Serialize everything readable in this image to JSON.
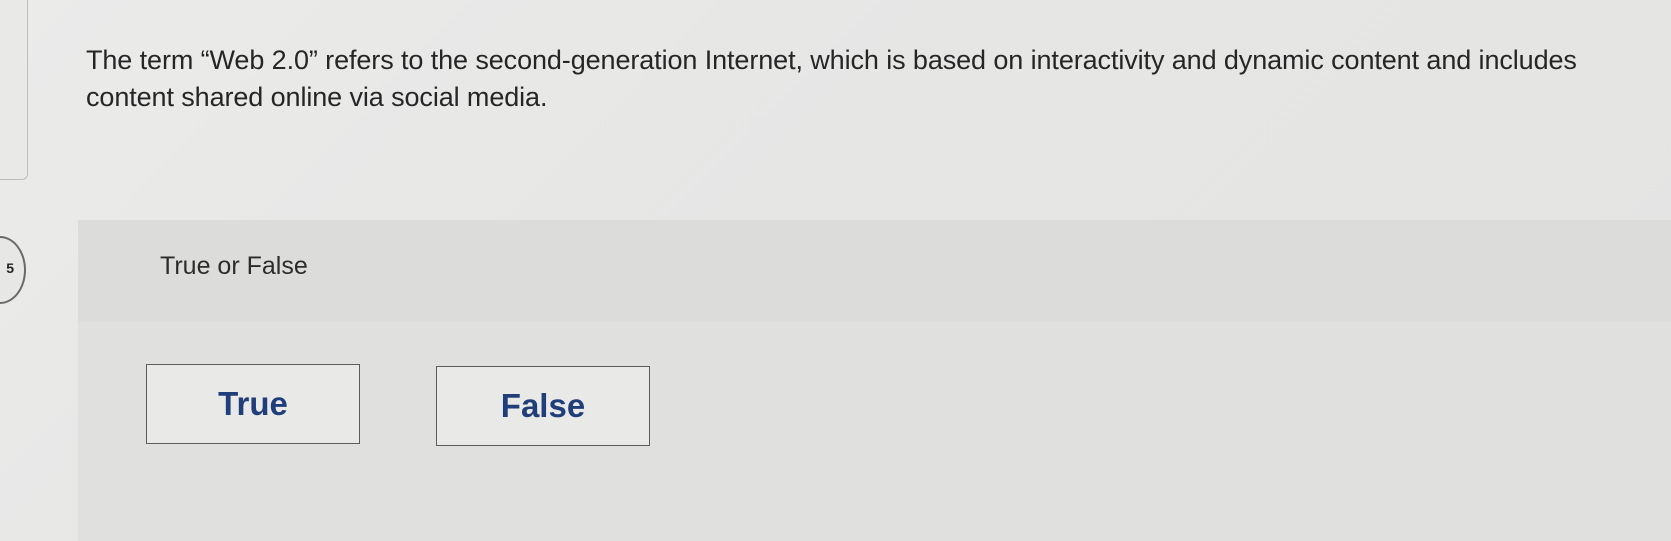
{
  "question": {
    "number": "5",
    "text": "The term “Web 2.0” refers to the second-generation Internet, which is based on interactivity and dynamic content and includes content shared online via social media."
  },
  "answer": {
    "type_label": "True or False",
    "choices": [
      {
        "label": "True"
      },
      {
        "label": "False"
      }
    ]
  },
  "colors": {
    "choice_text": "#203f7a",
    "background": "#e6e6e5"
  }
}
